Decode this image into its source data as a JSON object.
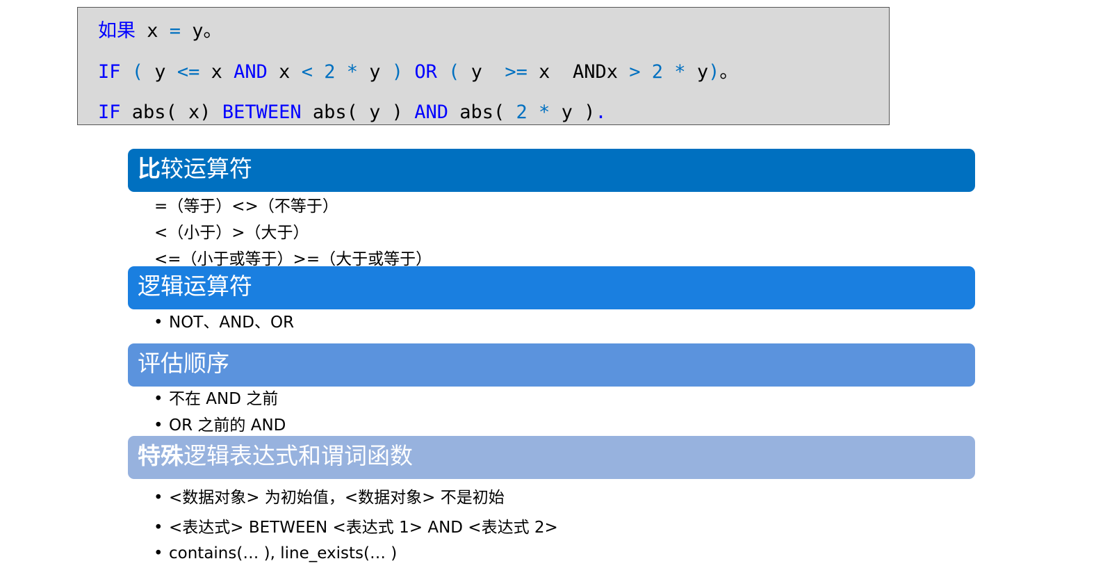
{
  "code": {
    "line1": [
      {
        "t": "如果",
        "c": "k"
      },
      {
        "t": " x ",
        "c": "p"
      },
      {
        "t": "=",
        "c": "c"
      },
      {
        "t": " y。",
        "c": "p"
      }
    ],
    "line2": [
      {
        "t": "IF",
        "c": "k"
      },
      {
        "t": " ",
        "c": "p"
      },
      {
        "t": "(",
        "c": "c"
      },
      {
        "t": " y ",
        "c": "p"
      },
      {
        "t": "<=",
        "c": "c"
      },
      {
        "t": " x ",
        "c": "p"
      },
      {
        "t": "AND",
        "c": "k"
      },
      {
        "t": " x ",
        "c": "p"
      },
      {
        "t": "<",
        "c": "c"
      },
      {
        "t": " ",
        "c": "p"
      },
      {
        "t": "2",
        "c": "c"
      },
      {
        "t": " ",
        "c": "p"
      },
      {
        "t": "*",
        "c": "c"
      },
      {
        "t": " y ",
        "c": "p"
      },
      {
        "t": ")",
        "c": "c"
      },
      {
        "t": " ",
        "c": "p"
      },
      {
        "t": "OR",
        "c": "k"
      },
      {
        "t": " ",
        "c": "p"
      },
      {
        "t": "(",
        "c": "c"
      },
      {
        "t": " y  ",
        "c": "p"
      },
      {
        "t": ">=",
        "c": "c"
      },
      {
        "t": " x  ANDx ",
        "c": "p"
      },
      {
        "t": ">",
        "c": "c"
      },
      {
        "t": " ",
        "c": "p"
      },
      {
        "t": "2",
        "c": "c"
      },
      {
        "t": " ",
        "c": "p"
      },
      {
        "t": "*",
        "c": "c"
      },
      {
        "t": " y",
        "c": "p"
      },
      {
        "t": ")",
        "c": "c"
      },
      {
        "t": "。",
        "c": "p"
      }
    ],
    "line3": [
      {
        "t": "IF",
        "c": "k"
      },
      {
        "t": " abs( x) ",
        "c": "p"
      },
      {
        "t": "BETWEEN",
        "c": "k"
      },
      {
        "t": " abs( y ) ",
        "c": "p"
      },
      {
        "t": "AND",
        "c": "k"
      },
      {
        "t": " abs( ",
        "c": "p"
      },
      {
        "t": "2",
        "c": "c"
      },
      {
        "t": " ",
        "c": "p"
      },
      {
        "t": "*",
        "c": "c"
      },
      {
        "t": " y )",
        "c": "p"
      },
      {
        "t": ".",
        "c": "k"
      }
    ]
  },
  "sections": {
    "comparison": {
      "title_bold": "比",
      "title_rest": "较运算符",
      "color": "#0070c0",
      "items": [
        "=（等于）<>（不等于）",
        "<（小于）>（大于）",
        "<=（小于或等于）>=（大于或等于）"
      ]
    },
    "logical": {
      "title": "逻辑运算符",
      "color": "#1a7fe0",
      "items": [
        "NOT、AND、OR"
      ]
    },
    "order": {
      "title": "评估顺序",
      "color": "#5b93dd",
      "items": [
        "不在 AND 之前",
        "OR 之前的 AND"
      ]
    },
    "special": {
      "title_bold": "特殊",
      "title_rest": "逻辑表达式和谓词函数",
      "color": "#97b2de",
      "items": [
        "<数据对象> 为初始值，<数据对象> 不是初始",
        "<表达式> BETWEEN <表达式 1> AND <表达式 2>",
        "contains(… ), line_exists(… )"
      ]
    }
  },
  "bullet_glyph": "•"
}
